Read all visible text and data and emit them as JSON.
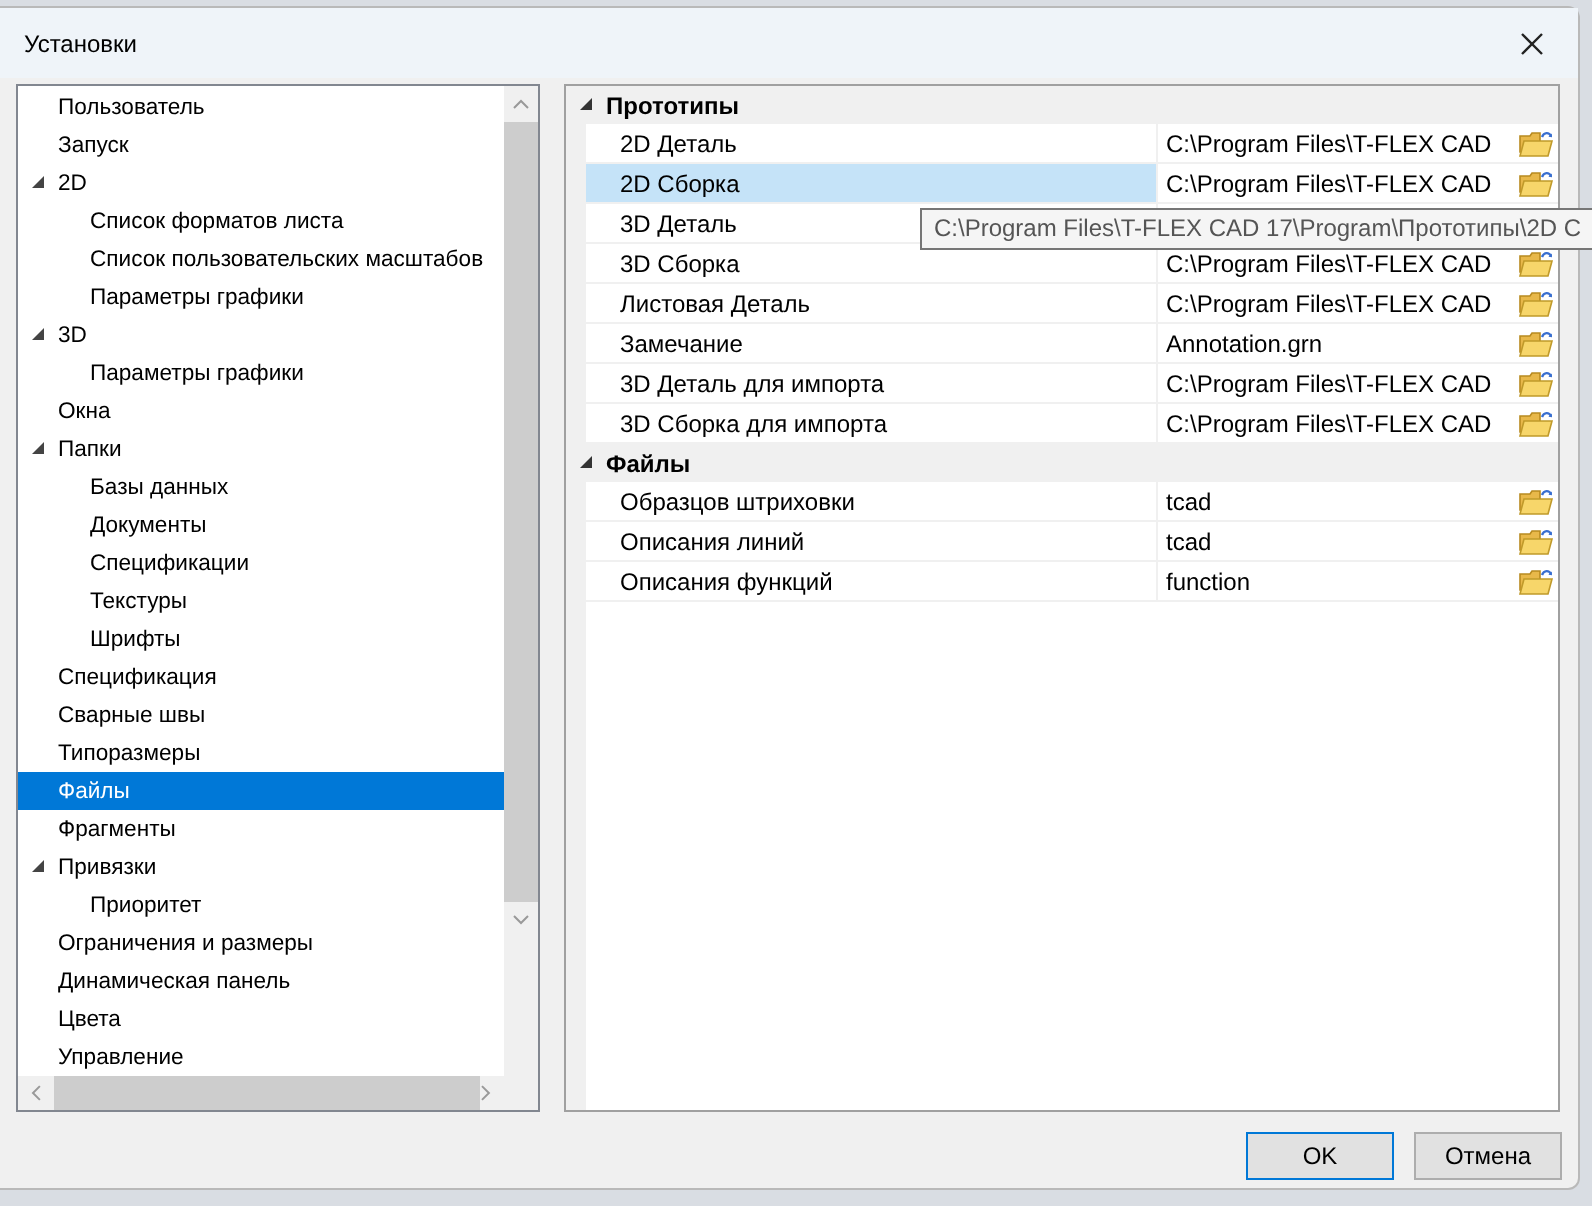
{
  "window": {
    "title": "Установки"
  },
  "tree": {
    "items": [
      {
        "label": "Пользователь",
        "selected": false
      },
      {
        "label": "Запуск",
        "selected": false
      },
      {
        "label": "2D",
        "selected": false,
        "expanded": true,
        "children": [
          {
            "label": "Список форматов листа",
            "selected": false
          },
          {
            "label": "Список пользовательских масштабов",
            "selected": false
          },
          {
            "label": "Параметры графики",
            "selected": false
          }
        ]
      },
      {
        "label": "3D",
        "selected": false,
        "expanded": true,
        "children": [
          {
            "label": "Параметры графики",
            "selected": false
          }
        ]
      },
      {
        "label": "Окна",
        "selected": false
      },
      {
        "label": "Папки",
        "selected": false,
        "expanded": true,
        "children": [
          {
            "label": "Базы данных",
            "selected": false
          },
          {
            "label": "Документы",
            "selected": false
          },
          {
            "label": "Спецификации",
            "selected": false
          },
          {
            "label": "Текстуры",
            "selected": false
          },
          {
            "label": "Шрифты",
            "selected": false
          }
        ]
      },
      {
        "label": "Спецификация",
        "selected": false
      },
      {
        "label": "Сварные швы",
        "selected": false
      },
      {
        "label": "Типоразмеры",
        "selected": false
      },
      {
        "label": "Файлы",
        "selected": true
      },
      {
        "label": "Фрагменты",
        "selected": false
      },
      {
        "label": "Привязки",
        "selected": false,
        "expanded": true,
        "children": [
          {
            "label": "Приоритет",
            "selected": false
          }
        ]
      },
      {
        "label": "Ограничения и размеры",
        "selected": false
      },
      {
        "label": "Динамическая панель",
        "selected": false
      },
      {
        "label": "Цвета",
        "selected": false
      },
      {
        "label": "Управление",
        "selected": false
      }
    ]
  },
  "properties": {
    "categories": [
      {
        "name": "Прототипы",
        "expanded": true,
        "rows": [
          {
            "label": "2D Деталь",
            "value": "C:\\Program Files\\T-FLEX CAD",
            "selected": false
          },
          {
            "label": "2D Сборка",
            "value": "C:\\Program Files\\T-FLEX CAD",
            "selected": true
          },
          {
            "label": "3D Деталь",
            "selected": false
          },
          {
            "label": "3D Сборка",
            "value": "C:\\Program Files\\T-FLEX CAD",
            "selected": false
          },
          {
            "label": "Листовая Деталь",
            "value": "C:\\Program Files\\T-FLEX CAD",
            "selected": false
          },
          {
            "label": "Замечание",
            "value": "Annotation.grn",
            "selected": false
          },
          {
            "label": "3D Деталь для импорта",
            "value": "C:\\Program Files\\T-FLEX CAD",
            "selected": false
          },
          {
            "label": "3D Сборка для импорта",
            "value": "C:\\Program Files\\T-FLEX CAD",
            "selected": false
          }
        ]
      },
      {
        "name": "Файлы",
        "expanded": true,
        "rows": [
          {
            "label": "Образцов штриховки",
            "value": "tcad",
            "selected": false
          },
          {
            "label": "Описания линий",
            "value": "tcad",
            "selected": false
          },
          {
            "label": "Описания функций",
            "value": "function",
            "selected": false
          }
        ]
      }
    ]
  },
  "tooltip": {
    "text": "C:\\Program Files\\T-FLEX CAD 17\\Program\\Прототипы\\2D С"
  },
  "buttons": [
    {
      "label": "OK",
      "default": true
    },
    {
      "label": "Отмена",
      "default": false
    }
  ]
}
